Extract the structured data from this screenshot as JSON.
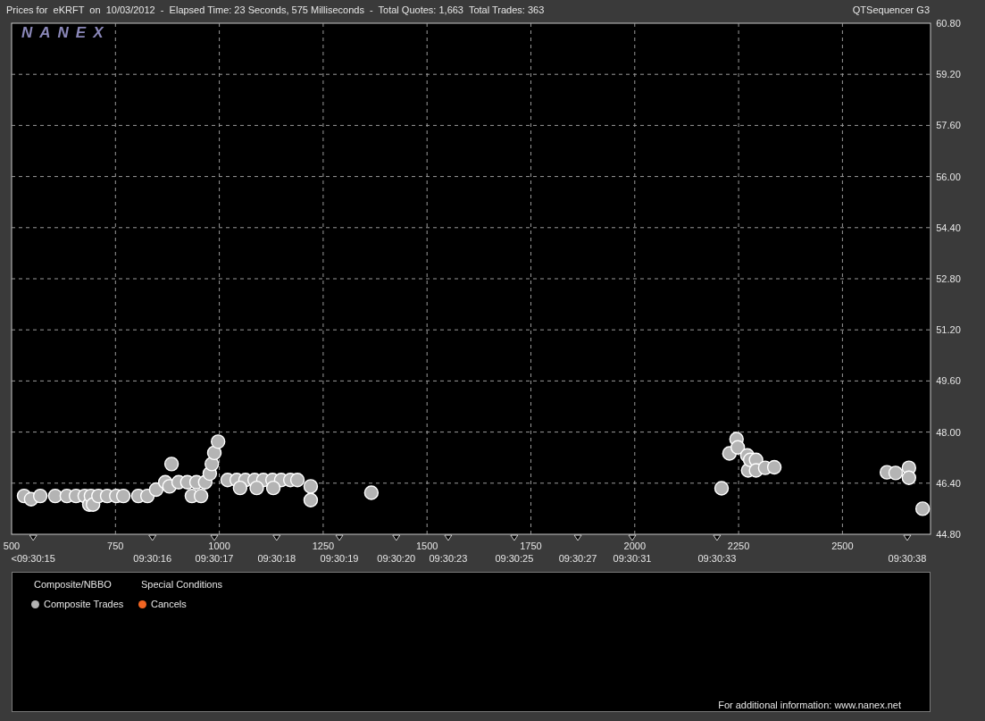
{
  "header": {
    "title": "Prices for  eKRFT  on  10/03/2012  -  Elapsed Time: 23 Seconds, 575 Milliseconds  -  Total Quotes: 1,663  Total Trades: 363",
    "app": "QTSequencer G3"
  },
  "logo": "NANEX",
  "chart_data": {
    "type": "scatter",
    "x": [
      530,
      547,
      569,
      605,
      633,
      655,
      676,
      687,
      691,
      696,
      709,
      730,
      752,
      769,
      805,
      827,
      848,
      870,
      880,
      885,
      902,
      923,
      934,
      945,
      956,
      966,
      977,
      982,
      988,
      997,
      1020,
      1042,
      1063,
      1085,
      1106,
      1128,
      1149,
      1171,
      1188,
      1050,
      1090,
      1130,
      1220,
      1220,
      1366,
      2209,
      2228,
      2245,
      2248,
      2271,
      2273,
      2278,
      2292,
      2292,
      2314,
      2336,
      2607,
      2628,
      2660,
      2660,
      2693
    ],
    "series": [
      {
        "name": "Composite Trades",
        "color": "#b4b4b4",
        "values": [
          46.0,
          45.9,
          46.0,
          46.0,
          46.0,
          46.0,
          46.0,
          45.73,
          46.0,
          45.73,
          46.0,
          46.0,
          46.0,
          46.0,
          46.0,
          46.0,
          46.2,
          46.43,
          46.3,
          47.0,
          46.43,
          46.43,
          46.0,
          46.43,
          46.0,
          46.43,
          46.7,
          47.0,
          47.35,
          47.7,
          46.5,
          46.5,
          46.5,
          46.5,
          46.5,
          46.5,
          46.5,
          46.5,
          46.5,
          46.25,
          46.25,
          46.25,
          46.3,
          45.87,
          46.1,
          46.24,
          47.33,
          47.78,
          47.52,
          47.27,
          46.8,
          47.13,
          47.13,
          46.8,
          46.88,
          46.9,
          46.74,
          46.72,
          46.88,
          46.57,
          45.6
        ]
      }
    ],
    "xlim": [
      500,
      2712
    ],
    "ylim": [
      44.8,
      60.8
    ],
    "xticks": [
      500,
      750,
      1000,
      1250,
      1500,
      1750,
      2000,
      2250,
      2500
    ],
    "yticks": [
      {
        "value": 44.8,
        "label": "44.80"
      },
      {
        "value": 46.4,
        "label": "46.40"
      },
      {
        "value": 48,
        "label": "48.00"
      },
      {
        "value": 49.6,
        "label": "49.60"
      },
      {
        "value": 51.2,
        "label": "51.20"
      },
      {
        "value": 52.8,
        "label": "52.80"
      },
      {
        "value": 54.4,
        "label": "54.40"
      },
      {
        "value": 56,
        "label": "56.00"
      },
      {
        "value": 57.6,
        "label": "57.60"
      },
      {
        "value": 59.2,
        "label": "59.20"
      },
      {
        "value": 60.8,
        "label": "60.80"
      }
    ],
    "grid": true
  },
  "time_axis": [
    "<09:30:15",
    "09:30:16",
    "09:30:17",
    "09:30:18",
    "09:30:19",
    "09:30:20",
    "09:30:23",
    "09:30:25",
    "09:30:27",
    "09:30:31",
    "09:30:33",
    "09:30:38"
  ],
  "legend": {
    "groups": [
      {
        "title": "Composite/NBBO",
        "kind": "series"
      },
      {
        "title": "Special Conditions",
        "kind": "items",
        "items": [
          {
            "label": "Cancels",
            "color": "#f26522"
          }
        ]
      }
    ]
  },
  "footer": "For additional information: www.nanex.net"
}
